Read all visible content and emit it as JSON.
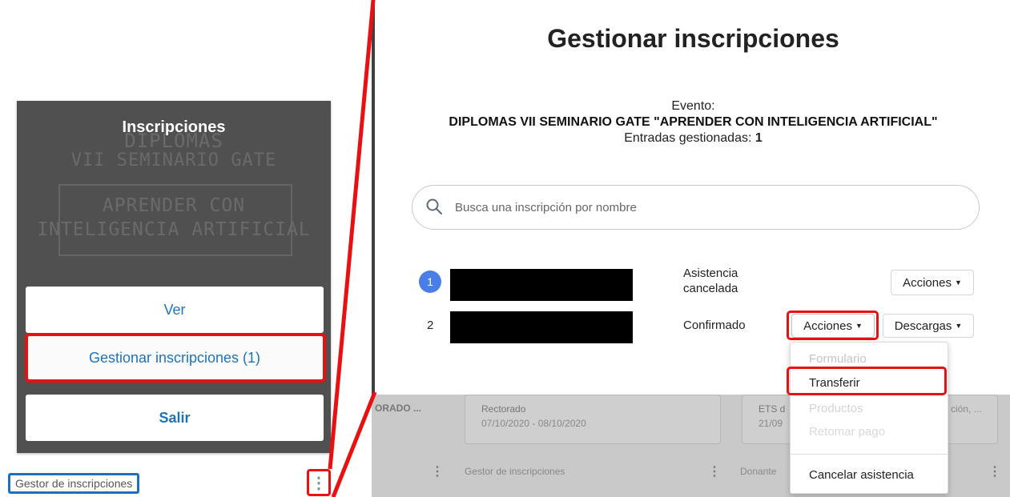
{
  "left_panel": {
    "menu_title": "Inscripciones",
    "background_text": [
      "DIPLOMAS",
      "VII SEMINARIO GATE",
      "APRENDER CON",
      "INTELIGENCIA ARTIFICIAL"
    ],
    "buttons": {
      "ver": "Ver",
      "gestionar": "Gestionar inscripciones (1)",
      "salir": "Salir"
    },
    "footer_label": "Gestor de inscripciones",
    "more_icon": "⋮"
  },
  "right_panel": {
    "title": "Gestionar inscripciones",
    "event_label": "Evento:",
    "event_name": "DIPLOMAS VII SEMINARIO GATE \"APRENDER CON INTELIGENCIA ARTIFICIAL\"",
    "entries_label": "Entradas gestionadas:",
    "entries_count": "1",
    "search": {
      "placeholder": "Busca una inscripción por nombre"
    },
    "rows": [
      {
        "number": "1",
        "status_line1": "Asistencia",
        "status_line2": "cancelada",
        "actions_label": "Acciones"
      },
      {
        "number": "2",
        "status": "Confirmado",
        "actions_label": "Acciones",
        "downloads_label": "Descargas"
      }
    ],
    "dropdown": {
      "items": [
        "Formulario",
        "Transferir",
        "Productos",
        "Retomar pago",
        "Cancelar asistencia"
      ]
    },
    "background_cards": {
      "card_a": "ORADO ...",
      "card_b_title": "Rectorado",
      "card_b_dates": "07/10/2020 - 08/10/2020",
      "card_c_title": "ETS d",
      "card_c_dates": "21/09",
      "card_c_extra": "ción, ...",
      "footer_b": "Gestor de inscripciones",
      "footer_c": "Donante"
    }
  },
  "colors": {
    "highlight_red": "#e81010",
    "highlight_blue": "#1d6fc0",
    "link_blue": "#1f73b7",
    "badge_blue": "#4a7ee7"
  }
}
